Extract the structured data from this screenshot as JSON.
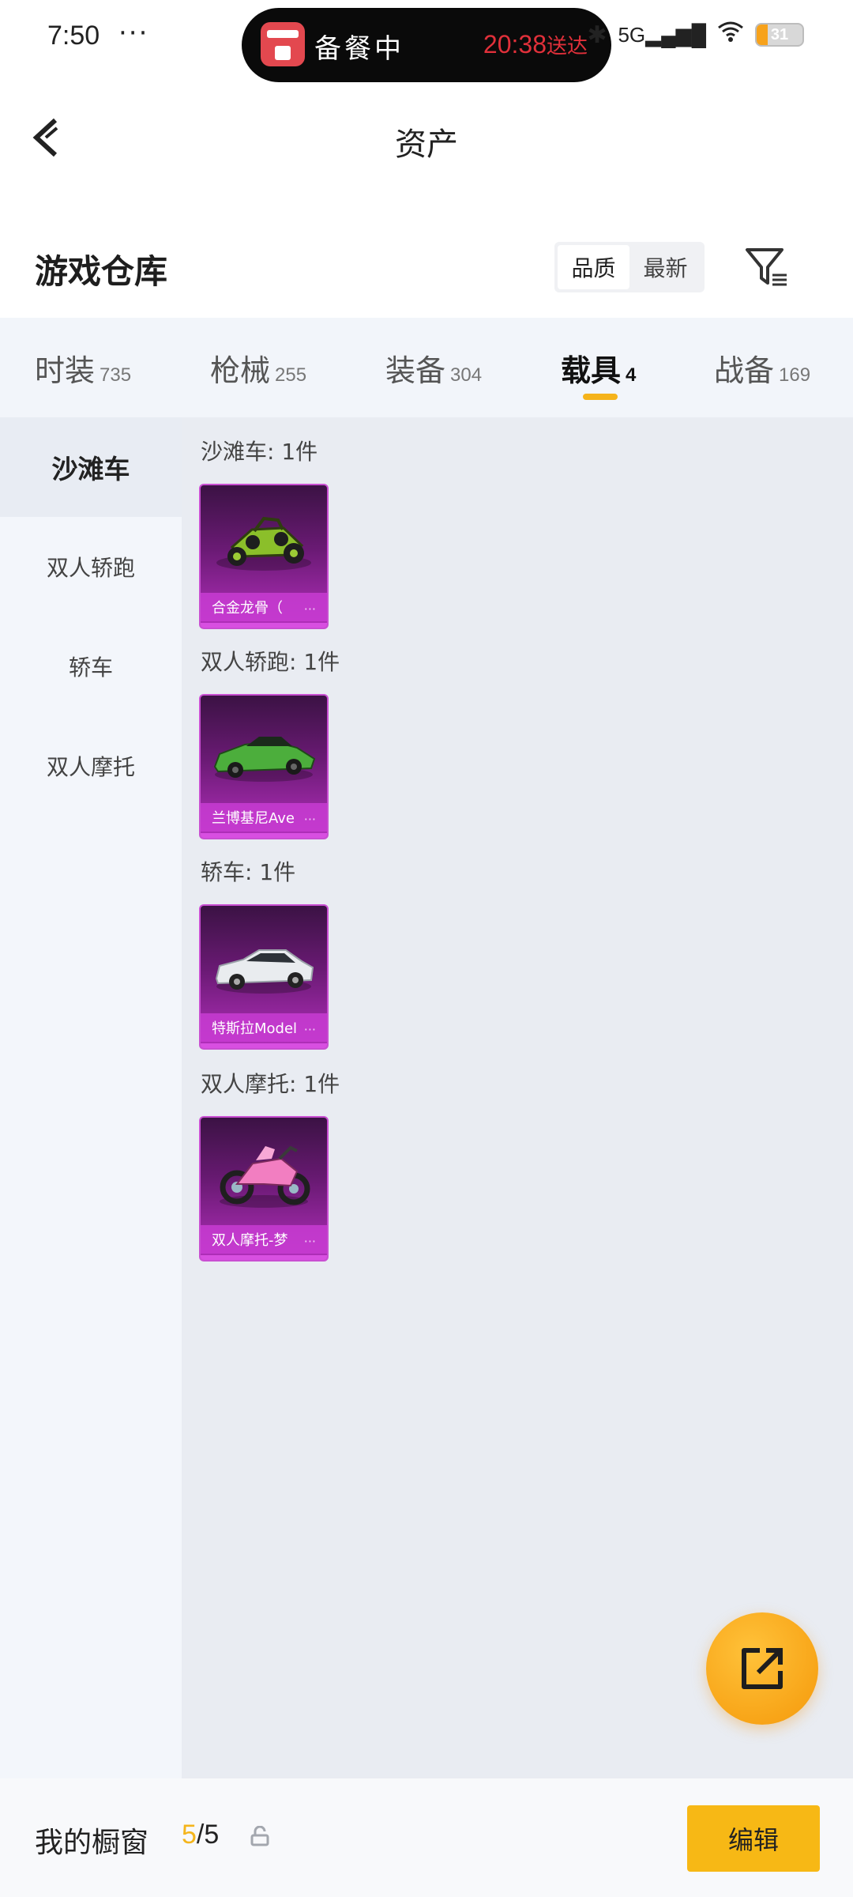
{
  "status_bar": {
    "time": "7:50",
    "dots": "···",
    "island_text": "备餐中",
    "eta_time": "20:38",
    "eta_suffix": "送达",
    "network": "5G",
    "battery": "31"
  },
  "nav": {
    "title": "资产"
  },
  "section": {
    "title": "游戏仓库",
    "sort_options": [
      "品质",
      "最新"
    ]
  },
  "tabs": [
    {
      "label": "时装",
      "count": "735"
    },
    {
      "label": "枪械",
      "count": "255"
    },
    {
      "label": "装备",
      "count": "304"
    },
    {
      "label": "载具",
      "count": "4"
    },
    {
      "label": "战备",
      "count": "169"
    }
  ],
  "sidebar": [
    {
      "label": "沙滩车"
    },
    {
      "label": "双人轿跑"
    },
    {
      "label": "轿车"
    },
    {
      "label": "双人摩托"
    }
  ],
  "groups": [
    {
      "title": "沙滩车: 1件",
      "item_label": "合金龙骨（",
      "icon": "buggy-icon"
    },
    {
      "title": "双人轿跑: 1件",
      "item_label": "兰博基尼Ave",
      "icon": "sports-car-icon"
    },
    {
      "title": "轿车: 1件",
      "item_label": "特斯拉Model",
      "icon": "sedan-icon"
    },
    {
      "title": "双人摩托: 1件",
      "item_label": "双人摩托-梦",
      "icon": "motorcycle-icon"
    }
  ],
  "more_mark": "···",
  "bottom_bar": {
    "label": "我的橱窗",
    "count_current": "5",
    "count_total": "/5",
    "edit_label": "编辑"
  },
  "colors": {
    "accent": "#f7b815",
    "card_purple": "#b32fbc",
    "tab_bg": "#f2f5fa",
    "content_bg": "#e9ecf2"
  }
}
